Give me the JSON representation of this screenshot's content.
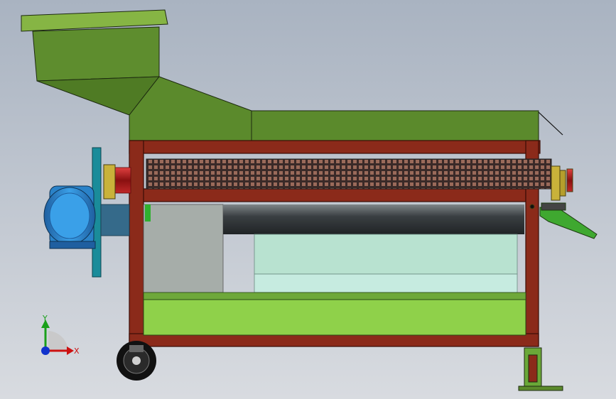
{
  "triad": {
    "y_label": "Y",
    "x_label": "X"
  },
  "colors": {
    "background_top": "#aab4c2",
    "background_bottom": "#d6dae0",
    "hopper": "#5b8a2c",
    "hopper_rim": "#86b544",
    "frame": "#8b2a1a",
    "frame_edge": "#3a0d06",
    "tray": "#8fd14a",
    "motor": "#2e8fd6",
    "motor_dark": "#1f5fa0",
    "screen_drum": "#2e3436",
    "bearing": "#c9b23a",
    "axis_x": "#cc1111",
    "axis_y": "#1aa01a",
    "axis_z": "#1133cc"
  }
}
